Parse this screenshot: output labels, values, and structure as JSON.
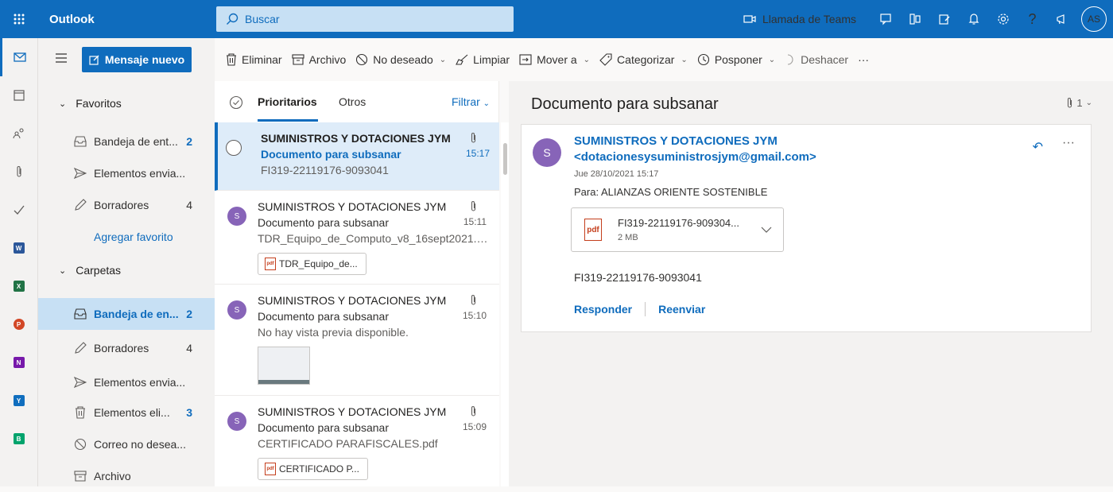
{
  "topbar": {
    "app_name": "Outlook",
    "search_placeholder": "Buscar",
    "teams_call": "Llamada de Teams",
    "avatar_initials": "AS",
    "help": "?"
  },
  "nav": {
    "new_message": "Mensaje nuevo",
    "favorites": {
      "label": "Favoritos",
      "items": [
        {
          "label": "Bandeja de ent...",
          "count": "2"
        },
        {
          "label": "Elementos envia...",
          "count": ""
        },
        {
          "label": "Borradores",
          "count": "4"
        }
      ],
      "add_favorite": "Agregar favorito"
    },
    "folders": {
      "label": "Carpetas",
      "items": [
        {
          "label": "Bandeja de en...",
          "count": "2"
        },
        {
          "label": "Borradores",
          "count": "4"
        },
        {
          "label": "Elementos envia...",
          "count": ""
        },
        {
          "label": "Elementos eli...",
          "count": "3"
        },
        {
          "label": "Correo no desea...",
          "count": ""
        },
        {
          "label": "Archivo",
          "count": ""
        }
      ]
    }
  },
  "commands": {
    "delete": "Eliminar",
    "archive": "Archivo",
    "junk": "No deseado",
    "sweep": "Limpiar",
    "move": "Mover a",
    "categorize": "Categorizar",
    "snooze": "Posponer",
    "undo": "Deshacer",
    "more": "···"
  },
  "list": {
    "tab_focused": "Prioritarios",
    "tab_other": "Otros",
    "filter": "Filtrar",
    "messages": [
      {
        "avatar": "",
        "sender": "SUMINISTROS Y DOTACIONES JYM",
        "subject": "Documento para subsanar",
        "time": "15:17",
        "preview": "FI319-22119176-9093041",
        "attachment": "",
        "selected": true
      },
      {
        "avatar": "S",
        "sender": "SUMINISTROS Y DOTACIONES JYM",
        "subject": "Documento para subsanar",
        "time": "15:11",
        "preview": "TDR_Equipo_de_Computo_v8_16sept2021.d...",
        "attachment": "TDR_Equipo_de..."
      },
      {
        "avatar": "S",
        "sender": "SUMINISTROS Y DOTACIONES JYM",
        "subject": "Documento para subsanar",
        "time": "15:10",
        "preview": "No hay vista previa disponible.",
        "attachment": ""
      },
      {
        "avatar": "S",
        "sender": "SUMINISTROS Y DOTACIONES JYM",
        "subject": "Documento para subsanar",
        "time": "15:09",
        "preview": "CERTIFICADO PARAFISCALES.pdf",
        "attachment": "CERTIFICADO P..."
      }
    ]
  },
  "reading": {
    "title": "Documento para subsanar",
    "attachment_count": "1",
    "avatar": "S",
    "from_name": "SUMINISTROS Y DOTACIONES JYM",
    "from_email": "<dotacionesysuministrosjym@gmail.com>",
    "date": "Jue 28/10/2021 15:17",
    "to": "Para:  ALIANZAS ORIENTE SOSTENIBLE",
    "attachment": {
      "name": "FI319-22119176-909304...",
      "size": "2 MB",
      "icon_text": "pdf"
    },
    "body": "FI319-22119176-9093041",
    "reply": "Responder",
    "forward": "Reenviar"
  },
  "icons": {
    "pdf_small": "pdf"
  },
  "colors": {
    "brand": "#0f6cbd",
    "avatar": "#8764b8",
    "selected_bg": "#deecf9"
  }
}
